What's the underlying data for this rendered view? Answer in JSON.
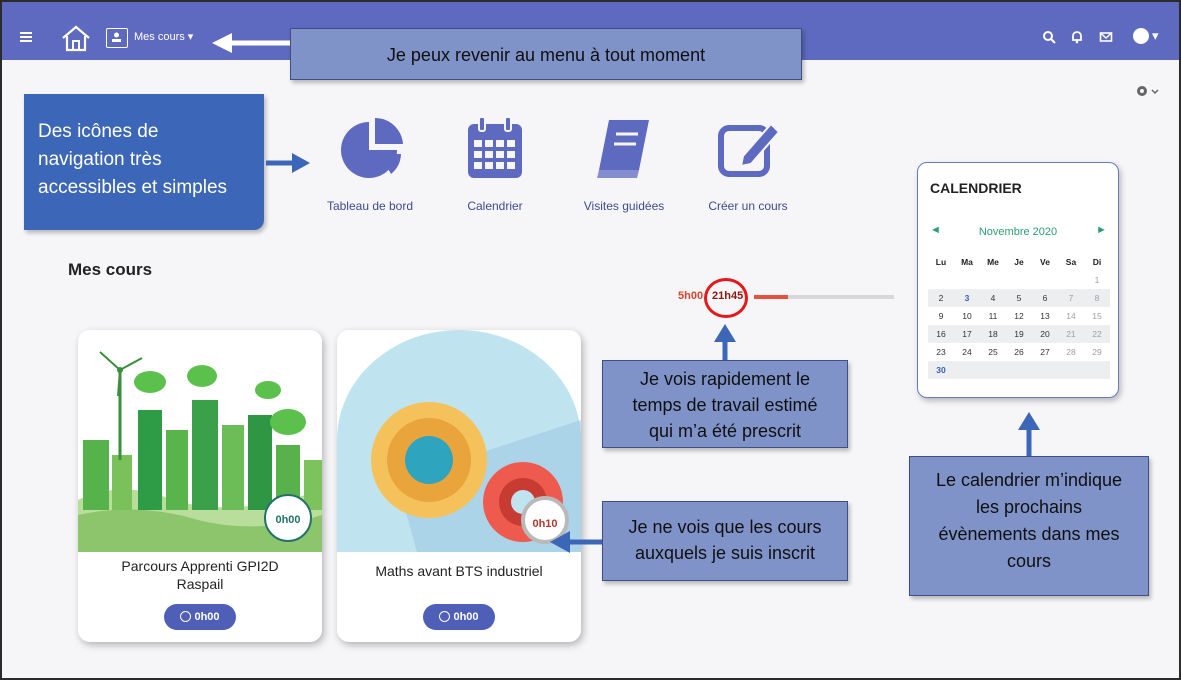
{
  "navbar": {
    "menu_label": "Mes cours",
    "accent": "#5d6abf"
  },
  "callouts": {
    "menu": "Je peux revenir au menu à tout moment",
    "nav_line1": "Des icônes de",
    "nav_line2": "navigation très",
    "nav_line3": "accessibles et simples",
    "time_line1": "Je vois rapidement le",
    "time_line2": "temps de travail estimé",
    "time_line3": "qui m’a été prescrit",
    "inscrit_line1": "Je ne vois que les cours",
    "inscrit_line2": "auxquels je suis inscrit",
    "cal_line1": "Le calendrier m’indique",
    "cal_line2": "les prochains",
    "cal_line3": "évènements dans mes",
    "cal_line4": "cours"
  },
  "nav_icons": [
    {
      "label": "Tableau de bord",
      "icon": "pie-chart-icon"
    },
    {
      "label": "Calendrier",
      "icon": "calendar-icon"
    },
    {
      "label": "Visites guidées",
      "icon": "book-icon"
    },
    {
      "label": "Créer un cours",
      "icon": "edit-icon"
    }
  ],
  "section": {
    "title": "Mes cours"
  },
  "progress": {
    "start": "5h00",
    "value": "21h45",
    "fraction": 0.24
  },
  "calendar": {
    "title": "CALENDRIER",
    "month": "Novembre 2020",
    "prev": "◄",
    "next": "►",
    "weekdays": [
      "Lu",
      "Ma",
      "Me",
      "Je",
      "Ve",
      "Sa",
      "Di"
    ],
    "weeks": [
      [
        "",
        "",
        "",
        "",
        "",
        "",
        "1"
      ],
      [
        "2",
        "3",
        "4",
        "5",
        "6",
        "7",
        "8"
      ],
      [
        "9",
        "10",
        "11",
        "12",
        "13",
        "14",
        "15"
      ],
      [
        "16",
        "17",
        "18",
        "19",
        "20",
        "21",
        "22"
      ],
      [
        "23",
        "24",
        "25",
        "26",
        "27",
        "28",
        "29"
      ],
      [
        "30",
        "",
        "",
        "",
        "",
        "",
        ""
      ]
    ]
  },
  "courses": [
    {
      "title_line1": "Parcours Apprenti GPI2D",
      "title_line2": "Raspail",
      "time_circle": "0h00",
      "badge": "0h00"
    },
    {
      "title_line1": "Maths avant BTS industriel",
      "title_line2": "",
      "time_circle": "0h10",
      "badge": "0h00"
    }
  ]
}
